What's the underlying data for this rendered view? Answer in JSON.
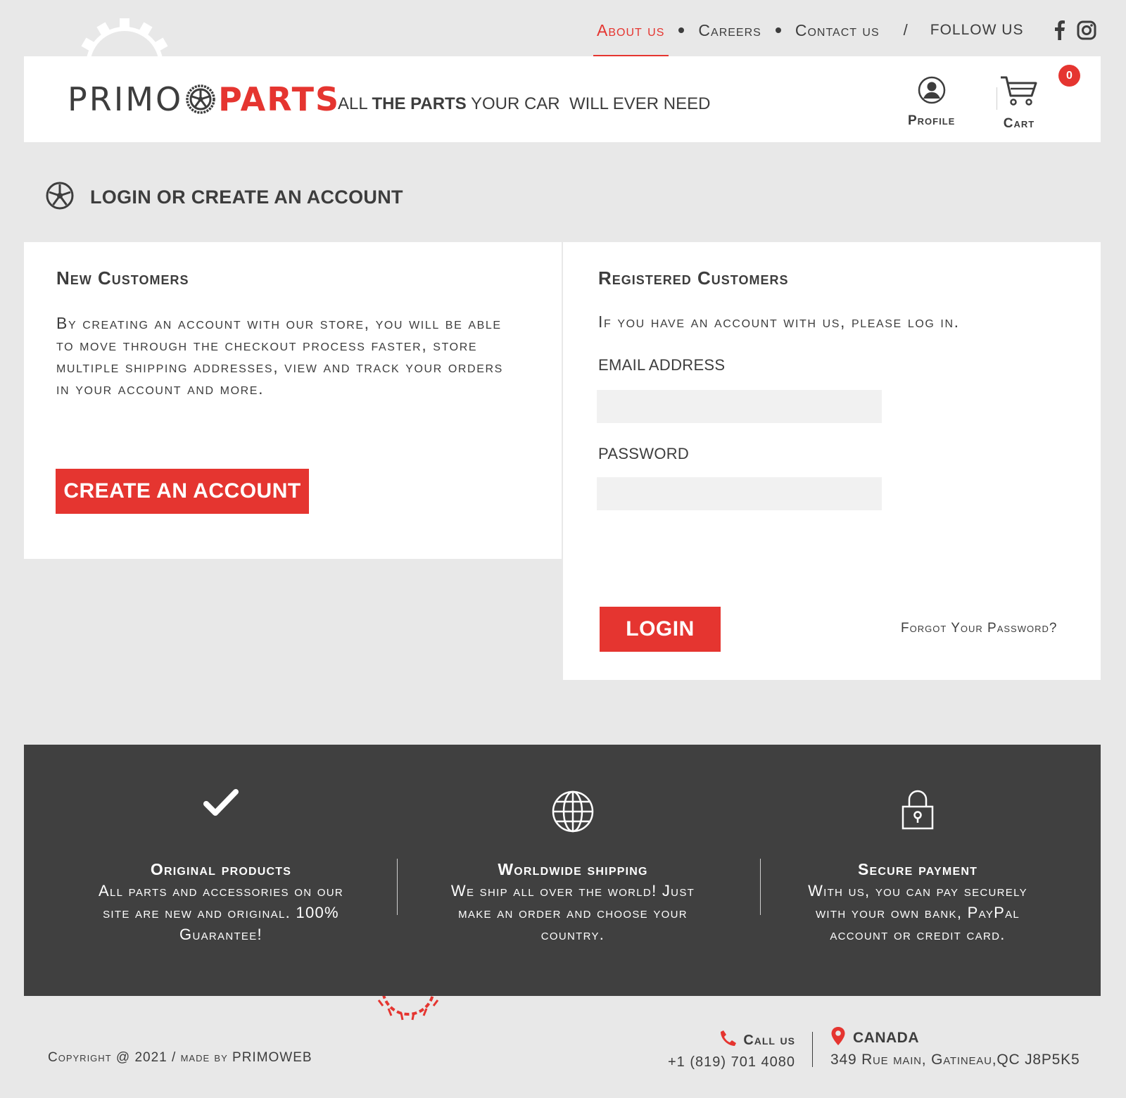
{
  "colors": {
    "accent": "#e53530",
    "dark": "#3d3d3d",
    "footer_bg": "#404040",
    "page_bg": "#e8e8e8"
  },
  "topnav": {
    "items": [
      {
        "label": "About us",
        "active": true
      },
      {
        "label": "Careers"
      },
      {
        "label": "Contact us"
      }
    ],
    "separator": "/",
    "follow_label": "FOLLOW US",
    "social_icons": [
      "facebook-icon",
      "instagram-icon"
    ]
  },
  "header": {
    "logo_left": "PRIMO",
    "logo_right": "PARTS",
    "tagline": {
      "p1": "ALL ",
      "b1": "THE PARTS",
      "p2": " YOUR CAR  WILL EVER NEED"
    },
    "profile_label": "Profile",
    "cart_label": "Cart",
    "cart_count": "0"
  },
  "page": {
    "title": "LOGIN OR CREATE AN ACCOUNT"
  },
  "new_customers": {
    "heading": "New Customers",
    "description": "By creating an account with our store, you will be able to move through the checkout process faster, store multiple shipping addresses, view and track your orders in your account and more.",
    "button": "CREATE AN ACCOUNT"
  },
  "registered": {
    "heading": "Registered Customers",
    "intro": "If you have an account with us, please log in.",
    "email_label": "EMAIL ADDRESS",
    "email_value": "",
    "password_label": "PASSWORD",
    "password_value": "",
    "login_button": "LOGIN",
    "forgot_link": "Forgot Your Password?"
  },
  "features": [
    {
      "icon": "checkmark-icon",
      "title": "Original products",
      "text": "All parts and accessories on our site are new and original. 100% Guarantee!"
    },
    {
      "icon": "globe-icon",
      "title": "Worldwide shipping",
      "text": "We ship all over the world! Just make an order and choose your country."
    },
    {
      "icon": "lock-icon",
      "title": "Secure payment",
      "text": "With us, you can pay securely with your own bank, PayPal account or credit card."
    }
  ],
  "footer": {
    "copyright": "Copyright @ 2021 /  made by PRIMOWEB",
    "call_label": "Call us",
    "phone": "+1 (819) 701 4080",
    "country": "CANADA",
    "address": "349 Rue main, Gatineau,QC J8P5K5"
  }
}
